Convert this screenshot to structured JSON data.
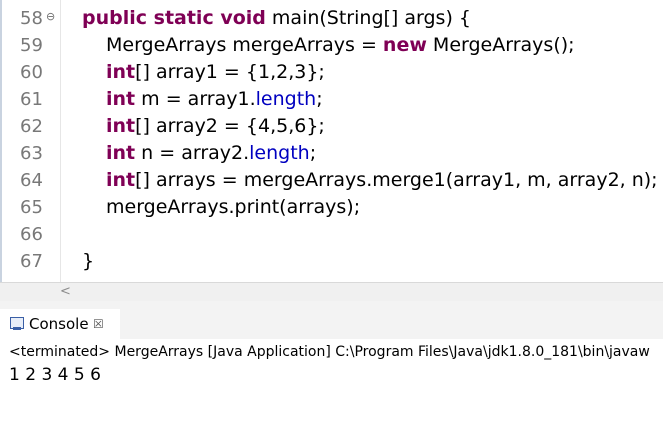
{
  "editor": {
    "lines": [
      {
        "number": "58",
        "fold": "⊖",
        "tokens": [
          {
            "text": "public static void",
            "cls": "kw"
          },
          {
            "text": " main(String[] args) {",
            "cls": ""
          }
        ]
      },
      {
        "number": "59",
        "tokens": [
          {
            "text": "MergeArrays mergeArrays = ",
            "cls": ""
          },
          {
            "text": "new",
            "cls": "kw"
          },
          {
            "text": " MergeArrays();",
            "cls": ""
          }
        ]
      },
      {
        "number": "60",
        "tokens": [
          {
            "text": "int",
            "cls": "kw"
          },
          {
            "text": "[] array1 = {1,2,3};",
            "cls": ""
          }
        ]
      },
      {
        "number": "61",
        "tokens": [
          {
            "text": "int",
            "cls": "kw"
          },
          {
            "text": " m = array1.",
            "cls": ""
          },
          {
            "text": "length",
            "cls": "fld"
          },
          {
            "text": ";",
            "cls": ""
          }
        ]
      },
      {
        "number": "62",
        "tokens": [
          {
            "text": "int",
            "cls": "kw"
          },
          {
            "text": "[] array2 = {4,5,6};",
            "cls": ""
          }
        ]
      },
      {
        "number": "63",
        "tokens": [
          {
            "text": "int",
            "cls": "kw"
          },
          {
            "text": " n = array2.",
            "cls": ""
          },
          {
            "text": "length",
            "cls": "fld"
          },
          {
            "text": ";",
            "cls": ""
          }
        ]
      },
      {
        "number": "64",
        "tokens": [
          {
            "text": "int",
            "cls": "kw"
          },
          {
            "text": "[] arrays = mergeArrays.merge1(array1, m, array2, n);",
            "cls": ""
          }
        ]
      },
      {
        "number": "65",
        "tokens": [
          {
            "text": "mergeArrays.print(arrays);",
            "cls": ""
          }
        ]
      },
      {
        "number": "66",
        "tokens": []
      },
      {
        "number": "67",
        "tokens": [
          {
            "text": "}",
            "cls": ""
          }
        ]
      }
    ]
  },
  "scrollbar": {
    "left_arrow": "<"
  },
  "console": {
    "tab_label": "Console",
    "close_glyph": "☒",
    "status": "<terminated> MergeArrays [Java Application] C:\\Program Files\\Java\\jdk1.8.0_181\\bin\\javaw",
    "output": "1 2 3 4 5 6"
  }
}
